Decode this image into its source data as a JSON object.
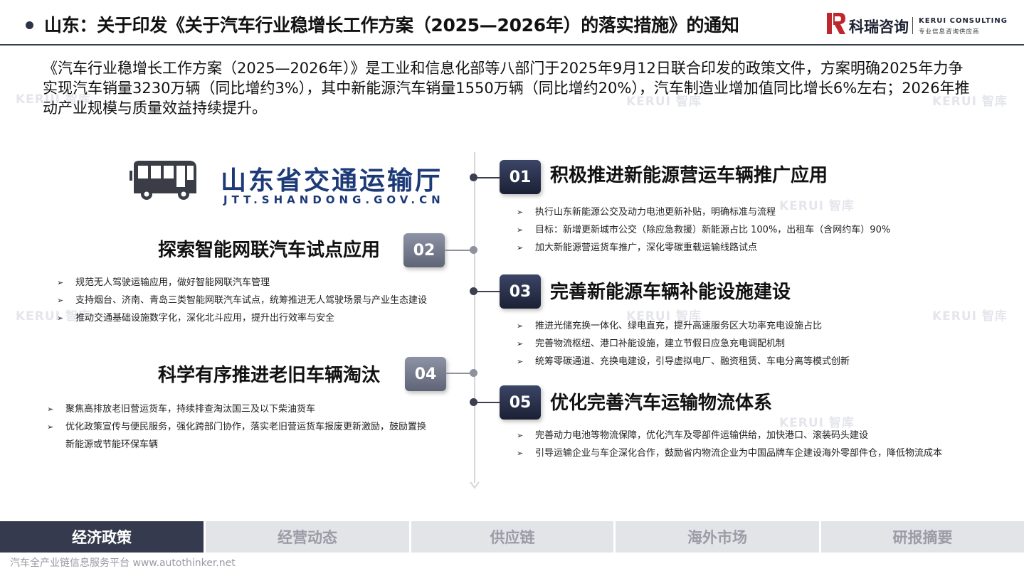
{
  "header": {
    "title": "山东：关于印发《关于汽车行业稳增长工作方案（2025—2026年）的落实措施》的通知",
    "logo_cn": "科瑞咨询",
    "logo_en": "KERUI CONSULTING",
    "logo_sub": "专业信息咨询供应商"
  },
  "intro": "《汽车行业稳增长工作方案（2025—2026年）》是工业和信息化部等八部门于2025年9月12日联合印发的政策文件，方案明确2025年力争实现汽车销量3230万辆（同比增约3%），其中新能源汽车销量1550万辆（同比增约20%），汽车制造业增加值同比增长6%左右；2026年推动产业规模与质量效益持续提升。",
  "watermark": "KERUI 智库",
  "agency": {
    "name": "山东省交通运输厅",
    "url": "JTT.SHANDONG.GOV.CN"
  },
  "sections": [
    {
      "num": "01",
      "title": "积极推进新能源营运车辆推广应用",
      "items": [
        "执行山东新能源公交及动力电池更新补贴，明确标准与流程",
        "目标：新增更新城市公交（除应急救援）新能源占比 100%，出租车（含网约车）90%",
        "加大新能源营运货车推广，深化零碳重载运输线路试点"
      ]
    },
    {
      "num": "02",
      "title": "探索智能网联汽车试点应用",
      "items": [
        "规范无人驾驶运输应用，做好智能网联汽车管理",
        "支持烟台、济南、青岛三类智能网联汽车试点，统筹推进无人驾驶场景与产业生态建设",
        "推动交通基础设施数字化，深化北斗应用，提升出行效率与安全"
      ]
    },
    {
      "num": "03",
      "title": "完善新能源车辆补能设施建设",
      "items": [
        "推进光储充换一体化、绿电直充，提升高速服务区大功率充电设施占比",
        "完善物流枢纽、港口补能设施，建立节假日应急充电调配机制",
        "统筹零碳通道、充换电建设，引导虚拟电厂、融资租赁、车电分离等模式创新"
      ]
    },
    {
      "num": "04",
      "title": "科学有序推进老旧车辆淘汰",
      "items": [
        "聚焦高排放老旧营运货车，持续排查淘汰国三及以下柴油货车",
        "优化政策宣传与便民服务，强化跨部门协作，落实老旧营运货车报废更新激励，鼓励置换新能源或节能环保车辆"
      ]
    },
    {
      "num": "05",
      "title": "优化完善汽车运输物流体系",
      "items": [
        "完善动力电池等物流保障，优化汽车及零部件运输供给，加快港口、滚装码头建设",
        "引导运输企业与车企深化合作，鼓励省内物流企业为中国品牌车企建设海外零部件仓，降低物流成本"
      ]
    }
  ],
  "tabs": [
    "经济政策",
    "经营动态",
    "供应链",
    "海外市场",
    "研报摘要"
  ],
  "footer": "汽车全产业链信息服务平台 www.autothinker.net",
  "colors": {
    "dark": "#363a4e",
    "agency_blue": "#1d3a78",
    "brand_red": "#c0262d"
  }
}
